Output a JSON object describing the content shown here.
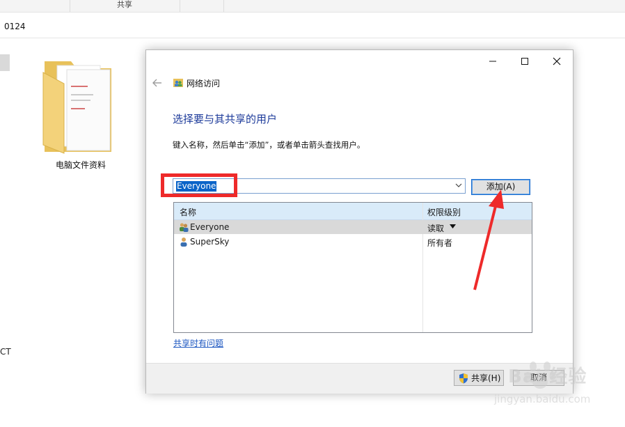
{
  "explorer": {
    "ribbon_tab": "共享",
    "address_text": "0124",
    "folder_label": "电脑文件资料",
    "side_label": "CT"
  },
  "dialog": {
    "header_title": "网络访问",
    "heading": "选择要与其共享的用户",
    "instruction": "键入名称，然后单击“添加”，或者单击箭头查找用户。",
    "name_input_value": "Everyone",
    "add_button": "添加(A)",
    "columns": {
      "name": "名称",
      "permission": "权限级别"
    },
    "users": [
      {
        "name": "Everyone",
        "permission": "读取"
      },
      {
        "name": "SuperSky",
        "permission": "所有者"
      }
    ],
    "help_link": "共享时有问题",
    "share_button": "共享(H)",
    "cancel_button": "取消"
  },
  "watermark": {
    "text": "Bai 经验",
    "url": "jingyan.baidu.com"
  },
  "icons": {
    "back": "back-arrow-icon",
    "network": "network-users-icon",
    "shield": "uac-shield-icon"
  },
  "colors": {
    "accent": "#1c3a9a",
    "selection": "#0a64c8",
    "annotation": "#ee2a2a",
    "header_bg": "#d9ebf9"
  }
}
